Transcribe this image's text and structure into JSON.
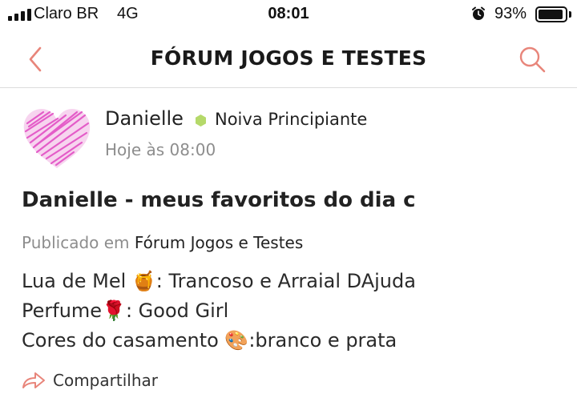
{
  "status_bar": {
    "carrier": "Claro BR",
    "network": "4G",
    "time": "08:01",
    "battery_percent": "93%",
    "battery_level": 0.93,
    "icons": [
      "signal-icon",
      "alarm-icon",
      "battery-icon"
    ]
  },
  "nav": {
    "title": "FÓRUM JOGOS E TESTES",
    "back_icon": "chevron-left-icon",
    "search_icon": "search-icon",
    "accent_color": "#e8857a"
  },
  "post": {
    "author": "Danielle",
    "author_level": "Noiva Principiante",
    "level_color": "#b5d96a",
    "avatar_color": "#e45cc8",
    "timestamp": "Hoje às 08:00",
    "title": "Danielle - meus favoritos do dia c",
    "published_prefix": "Publicado em",
    "forum_name": "Fórum Jogos e Testes",
    "body_lines": [
      {
        "text_before": "Lua de Mel ",
        "emoji": "🍯",
        "text_after": ": Trancoso e Arraial DAjuda"
      },
      {
        "text_before": "Perfume",
        "emoji": "🌹",
        "text_after": ": Good Girl"
      },
      {
        "text_before": "Cores do casamento ",
        "emoji": "🎨",
        "text_after": ":branco e prata"
      }
    ],
    "share_label": "Compartilhar"
  }
}
